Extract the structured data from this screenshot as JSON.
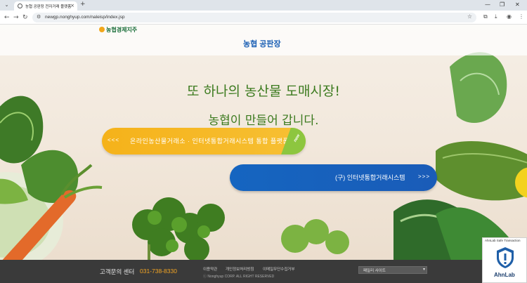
{
  "browser": {
    "tab_title": "농협 공판장 전자거래 플랫폼",
    "url": "newgp.nonghyup.com/naleisp/index.jsp",
    "menu_glyph": "⌄",
    "new_tab_glyph": "+",
    "close_glyph": "×",
    "back_glyph": "←",
    "forward_glyph": "→",
    "reload_glyph": "↻",
    "star_glyph": "☆",
    "minimize_glyph": "—",
    "restore_glyph": "❐",
    "window_close_glyph": "✕"
  },
  "header": {
    "brand_top": "농협경제지주",
    "site_logo": "농협 공판장"
  },
  "hero": {
    "headline_1": "또 하나의 농산물 도매시장!",
    "headline_2": "농협이 만들어 갑니다."
  },
  "buttons": {
    "yellow_arrows": "<<<",
    "yellow_label": "온라인농산물거래소 · 인터넷통합거래시스템 통합 플랫폼",
    "new_badge": "new",
    "blue_label": "(구) 인터넷통합거래시스템",
    "blue_arrows": ">>>"
  },
  "footer": {
    "cs_label": "고객문의 센터",
    "cs_phone": "031-738-8330",
    "links": [
      "이용약관",
      "개인정보처리방침",
      "이메일무단수집거부"
    ],
    "copyright": "ⓒ Nonghyup CORP. ALL RIGHT RESERVED",
    "family_site": "패밀리 사이트"
  },
  "ahnlab": {
    "title": "AhnLab Safe Transaction",
    "name": "AhnLab"
  }
}
